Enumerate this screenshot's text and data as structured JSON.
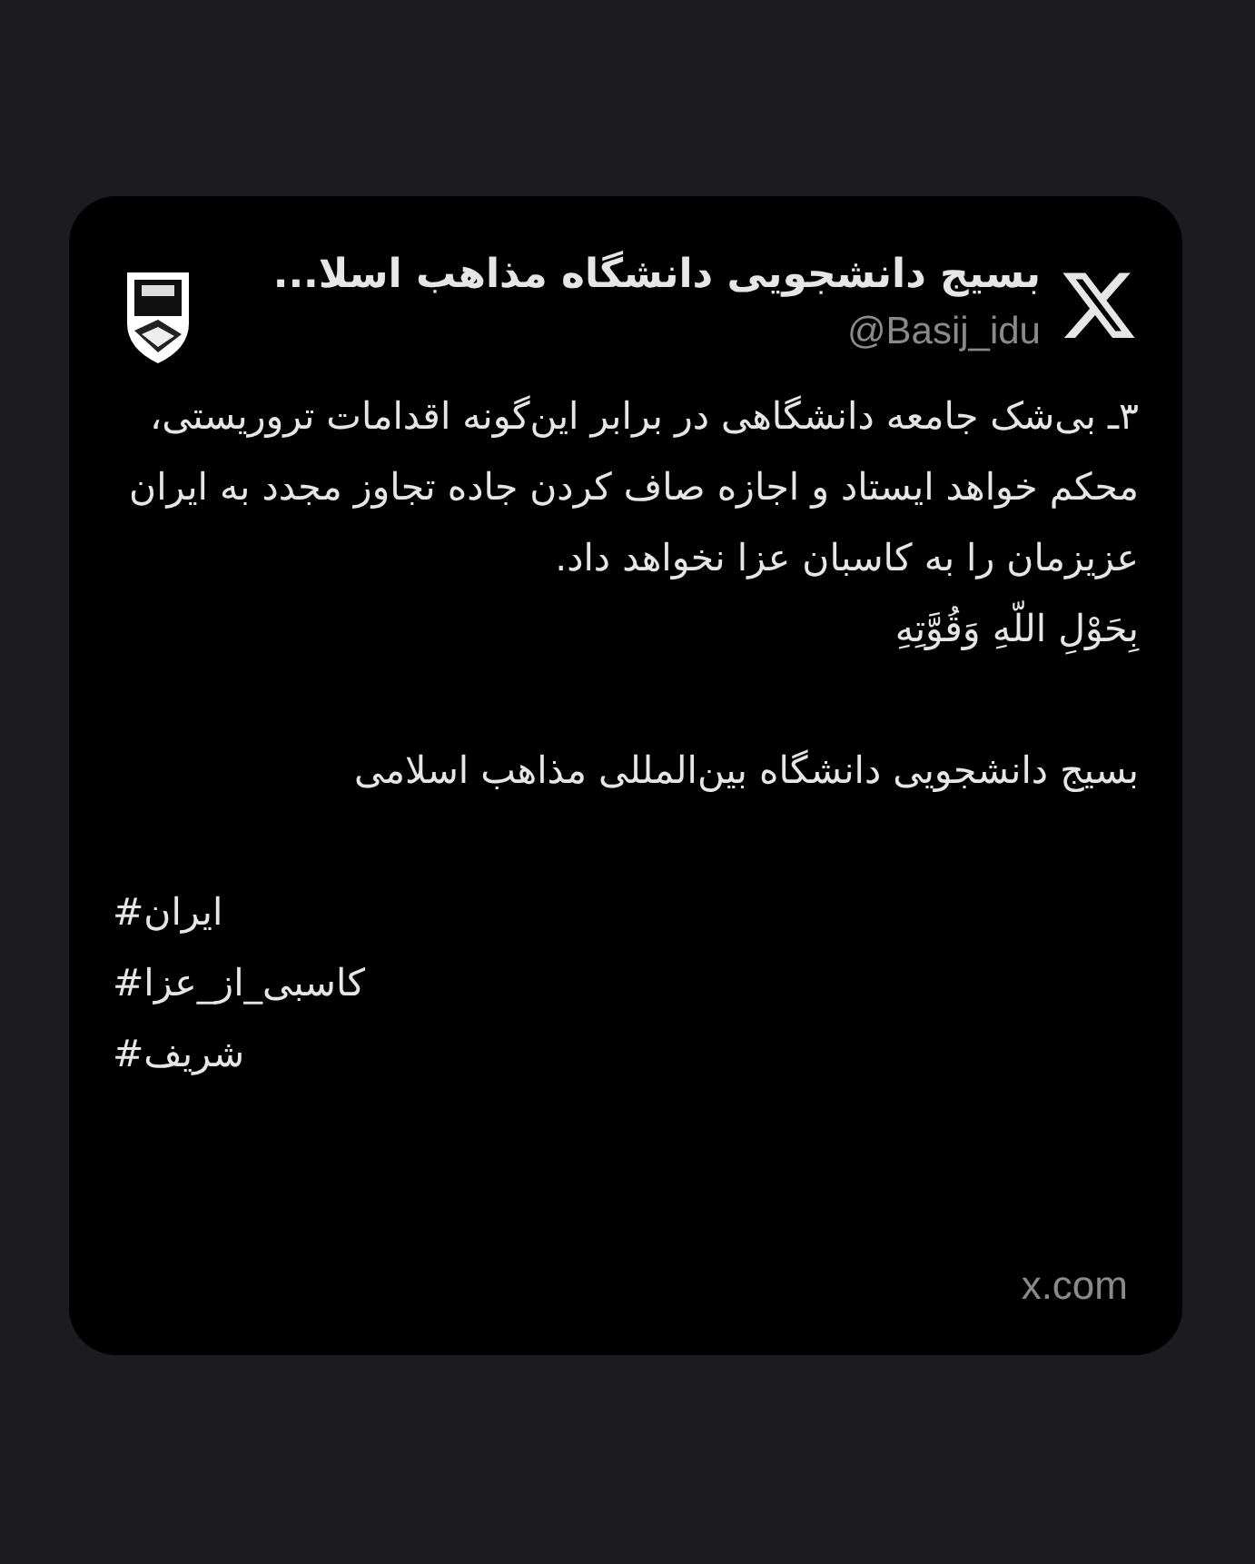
{
  "post": {
    "author": "بسیج دانشجویی دانشگاه مذاهب اسلا...",
    "handle": "@Basij_idu",
    "paragraphs": [
      "۳ـ بی‌شک جامعه دانشگاهی در برابر این‌گونه اقدامات تروریستی، محکم خواهد ایستاد و اجازه صاف کردن جاده تجاوز مجدد به ایران عزیزمان را به کاسبان عزا نخواهد داد.",
      "بِحَوْلِ اللّهِ وَقُوَّتِهِ"
    ],
    "signature": "بسیج دانشجویی دانشگاه بین‌المللی مذاهب اسلامی",
    "hashtags": [
      "ایران#",
      "کاسبی_از_عزا#",
      "شریف#"
    ],
    "source": "x.com"
  }
}
